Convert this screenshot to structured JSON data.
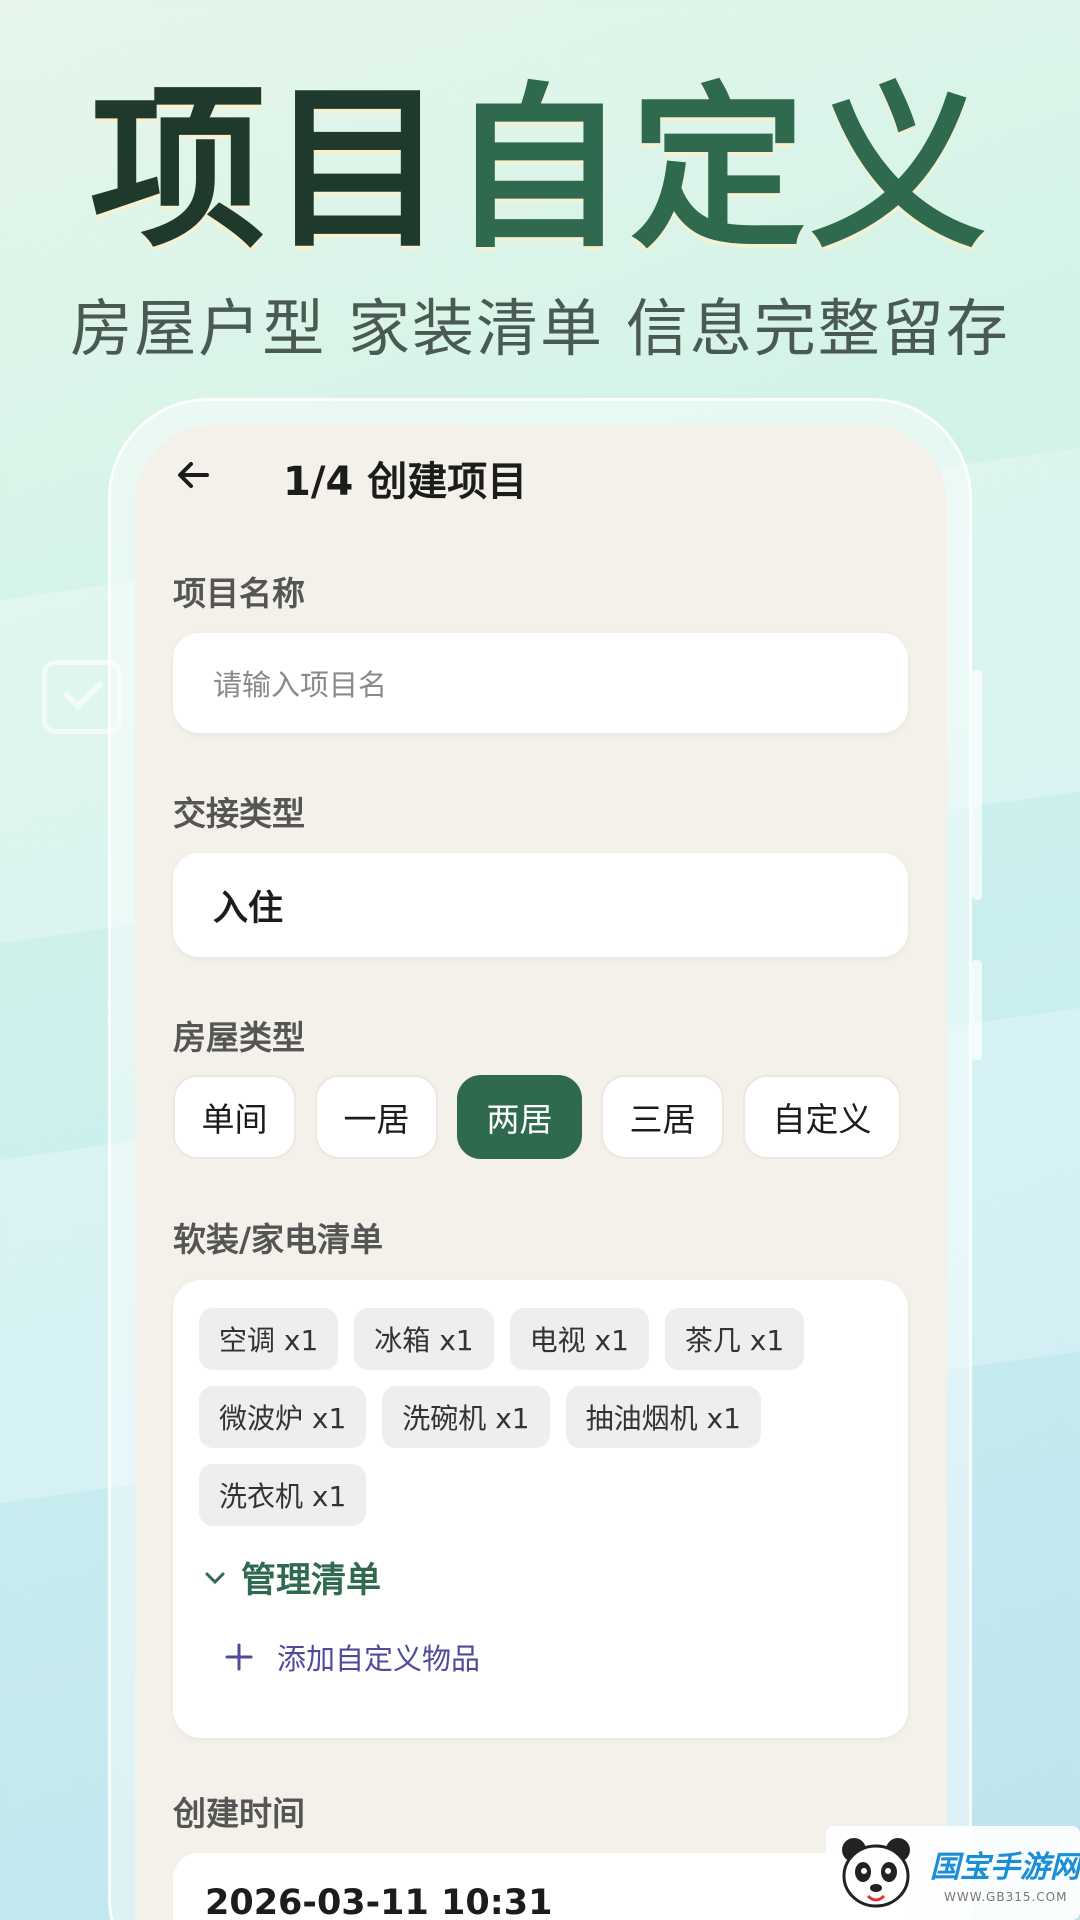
{
  "headline": {
    "part1": "项目",
    "part2": "自定义"
  },
  "subtitle": "房屋户型 家装清单 信息完整留存",
  "topbar": {
    "title": "1/4 创建项目"
  },
  "project_name": {
    "label": "项目名称",
    "placeholder": "请输入项目名"
  },
  "handover_type": {
    "label": "交接类型",
    "value": "入住"
  },
  "house_type": {
    "label": "房屋类型",
    "options": [
      "单间",
      "一居",
      "两居",
      "三居",
      "自定义"
    ],
    "selected": "两居"
  },
  "furnishing_list": {
    "label": "软装/家电清单",
    "items": [
      "空调 x1",
      "冰箱 x1",
      "电视 x1",
      "茶几 x1",
      "微波炉 x1",
      "洗碗机 x1",
      "抽油烟机 x1",
      "洗衣机 x1"
    ],
    "manage_label": "管理清单",
    "add_label": "添加自定义物品"
  },
  "created_time": {
    "label": "创建时间",
    "value": "2026-03-11 10:31"
  },
  "watermark": {
    "name": "国宝手游网",
    "url": "WWW.GB315.COM"
  },
  "colors": {
    "accent": "#2f6a4f",
    "dark": "#1f3a2d",
    "link": "#4f4a9a"
  }
}
